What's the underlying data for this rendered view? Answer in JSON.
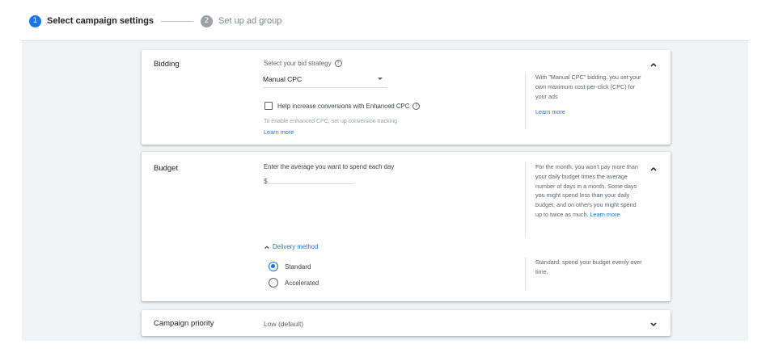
{
  "stepper": {
    "step1": {
      "number": "1",
      "label": "Select campaign settings"
    },
    "step2": {
      "number": "2",
      "label": "Set up ad group"
    }
  },
  "bidding": {
    "title": "Bidding",
    "strategy_label": "Select your bid strategy",
    "strategy_value": "Manual CPC",
    "enhanced_cpc_label": "Help increase conversions with Enhanced CPC",
    "enhanced_cpc_checked": false,
    "hint": "To enable enhanced CPC, set up conversion tracking",
    "learn_more": "Learn more",
    "side_text": "With \"Manual CPC\" bidding, you set your own maximum cost-per-click (CPC) for your ads",
    "side_link": "Learn more"
  },
  "budget": {
    "title": "Budget",
    "amount_label": "Enter the average you want to spend each day",
    "currency": "$",
    "side_text": "For the month, you won't pay more than your daily budget times the average number of days in a month. Some days you might spend less than your daily budget, and on others you might spend up to twice as much.",
    "side_link": "Learn more",
    "delivery_toggle": "Delivery method",
    "delivery_options": [
      {
        "label": "Standard",
        "selected": true
      },
      {
        "label": "Accelerated",
        "selected": false
      }
    ],
    "delivery_side_text": "Standard: spend your budget evenly over time."
  },
  "priority": {
    "title": "Campaign priority",
    "value": "Low (default)"
  },
  "colors": {
    "accent": "#1a73e8",
    "background": "#f1f3f4",
    "text": "#202124",
    "muted": "#5f6368"
  }
}
